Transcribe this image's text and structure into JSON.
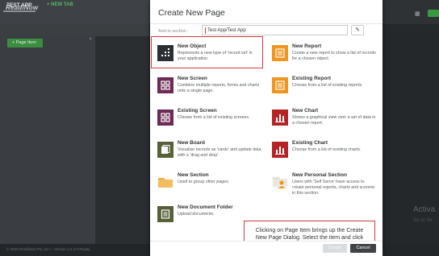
{
  "app": {
    "logo_line1": "ReadiNow",
    "logo_line2": "",
    "active_tab": "TEST APP",
    "new_tab": "+ NEW TAB",
    "page_item_button": "+ Page Item",
    "footer": "© 2020 ReadiNow Pty Ltd — Version 1.2.3.0-Ready",
    "activate_title": "Activa",
    "activate_sub": "Go to Se"
  },
  "modal": {
    "title": "Create New Page",
    "section_label": "Add to section :",
    "section_value": "Test App/Test App",
    "edit_icon": "pencil-icon",
    "items": [
      {
        "title": "New Object",
        "desc": "Represents a new type of 'record set' in your application.",
        "icon": "new-object-icon",
        "color": "#2b2f33"
      },
      {
        "title": "New Report",
        "desc": "Create a new report to show a list of records for a chosen object.",
        "icon": "report-icon",
        "color": "#f0951f"
      },
      {
        "title": "New Screen",
        "desc": "Combine multiple reports, forms and charts onto a single page.",
        "icon": "screen-icon",
        "color": "#6d2a55"
      },
      {
        "title": "Existing Report",
        "desc": "Choose from a list of existing reports.",
        "icon": "report-icon",
        "color": "#f0951f"
      },
      {
        "title": "Existing Screen",
        "desc": "Choose from a list of existing screens.",
        "icon": "screen-icon",
        "color": "#6d2a55"
      },
      {
        "title": "New Chart",
        "desc": "Shows a graphical view over a set of data in a chosen report.",
        "icon": "chart-icon",
        "color": "#b52424"
      },
      {
        "title": "New Board",
        "desc": "Visualise records as 'cards' and update data with a 'drag and drop'.",
        "icon": "board-icon",
        "color": "#56603a"
      },
      {
        "title": "Existing Chart",
        "desc": "Choose from a list of existing charts.",
        "icon": "chart-icon",
        "color": "#b52424"
      },
      {
        "title": "New Section",
        "desc": "Used to group other pages.",
        "icon": "folder-icon",
        "color": "#f0b04c"
      },
      {
        "title": "New Personal Section",
        "desc": "Users with 'Self Serve' have access to create personal reports, charts and screens in this section.",
        "icon": "personal-folder-icon",
        "color": "#f0b04c"
      },
      {
        "title": "New Document Folder",
        "desc": "Upload documents.",
        "icon": "document-folder-icon",
        "color": "#56603a"
      }
    ],
    "tooltip": "Clicking on Page Item brings up the Create New Page Dialog. Select the item and click on Create",
    "create_label": "Create",
    "cancel_label": "Cancel"
  }
}
